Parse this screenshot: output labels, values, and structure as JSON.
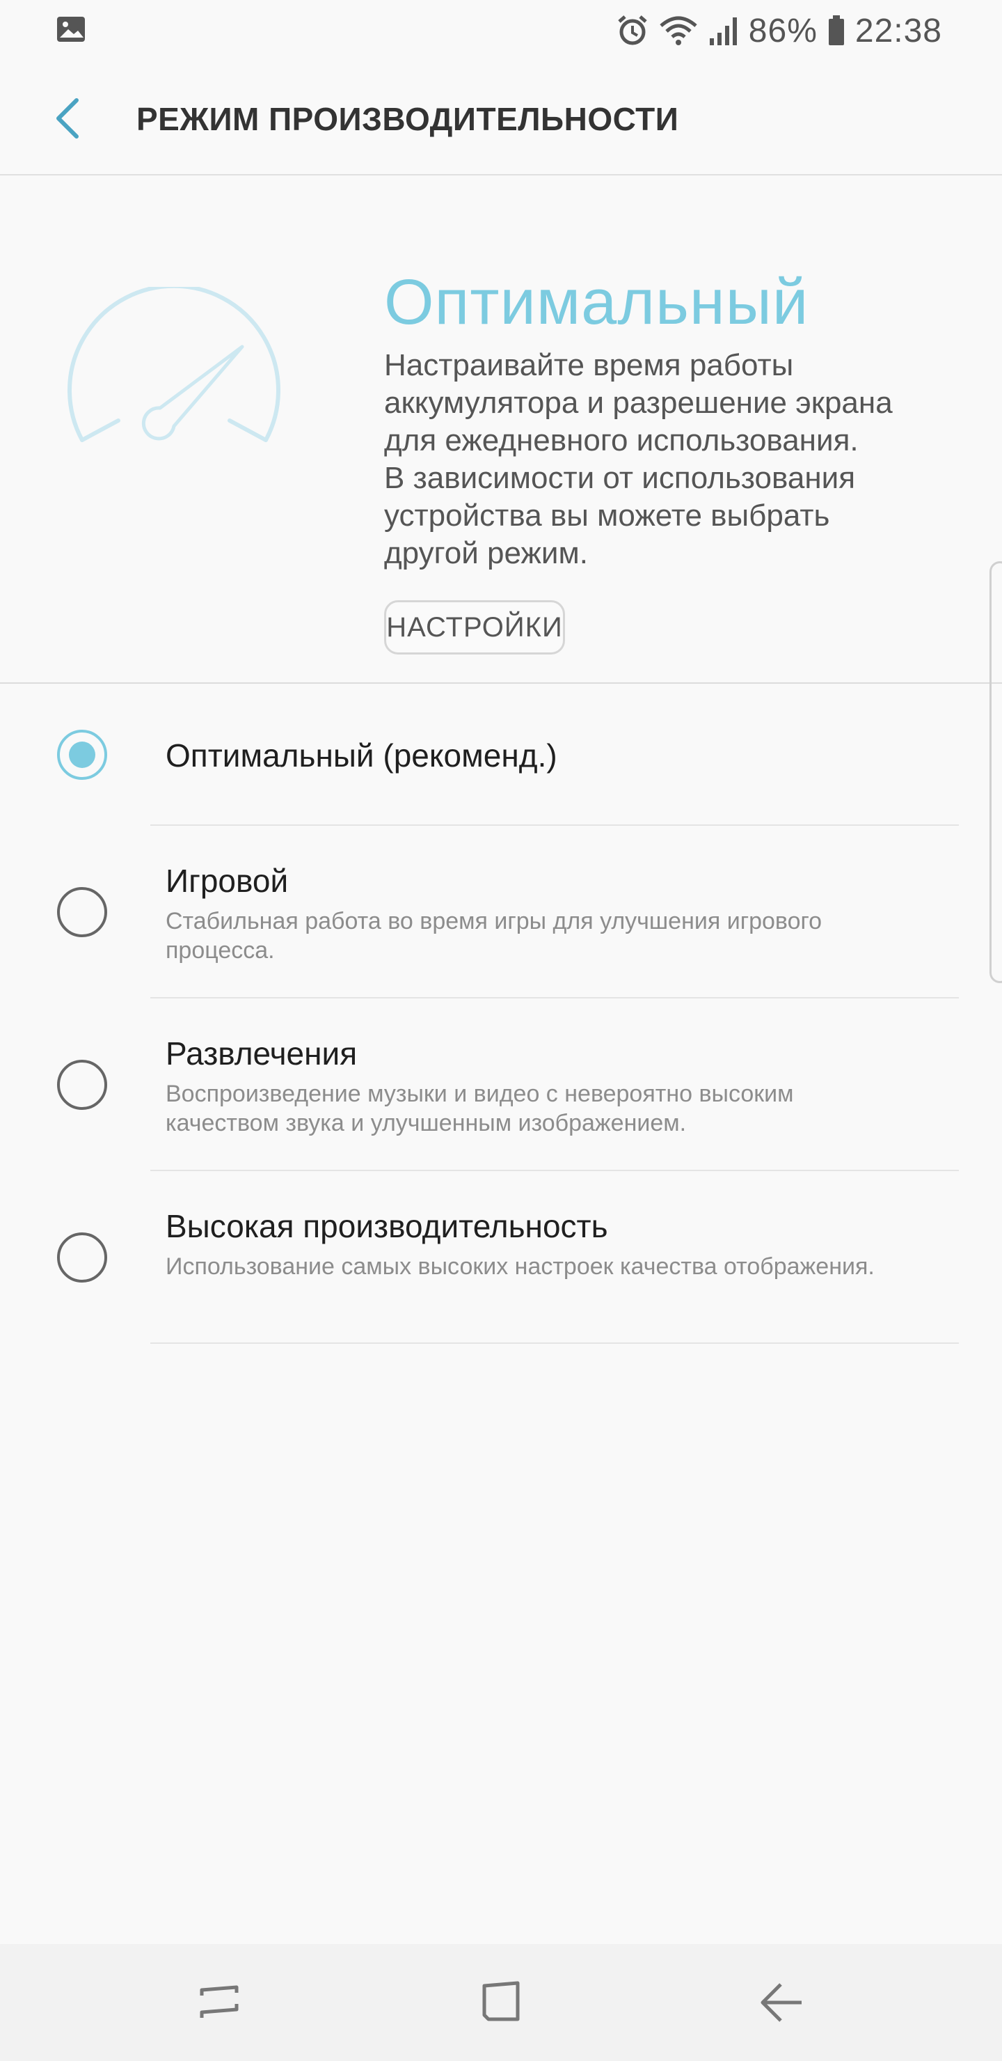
{
  "status_bar": {
    "battery_percent": "86%",
    "time": "22:38",
    "icons": [
      "image-icon",
      "alarm-icon",
      "wifi-icon",
      "signal-icon",
      "battery-icon"
    ]
  },
  "header": {
    "title": "РЕЖИМ ПРОИЗВОДИТЕЛЬНОСТИ"
  },
  "hero": {
    "title": "Оптимальный",
    "description": "Настраивайте время работы\nаккумулятора и разрешение экрана\nдля ежедневного использования.\nВ зависимости от использования\nустройства вы можете выбрать\nдругой режим.",
    "settings_label": "НАСТРОЙКИ"
  },
  "options": [
    {
      "title": "Оптимальный (рекоменд.)",
      "description": "",
      "selected": true
    },
    {
      "title": "Игровой",
      "description": "Стабильная работа во время игры для улучшения игрового процесса.",
      "selected": false
    },
    {
      "title": "Развлечения",
      "description": "Воспроизведение музыки и видео с невероятно высоким качеством звука и улучшенным изображением.",
      "selected": false
    },
    {
      "title": "Высокая производительность",
      "description": "Использование самых высоких настроек качества отображения.",
      "selected": false
    }
  ],
  "colors": {
    "accent": "#7ccbe0",
    "background": "#f9f9f9",
    "nav_bar": "#f2f2f2"
  }
}
